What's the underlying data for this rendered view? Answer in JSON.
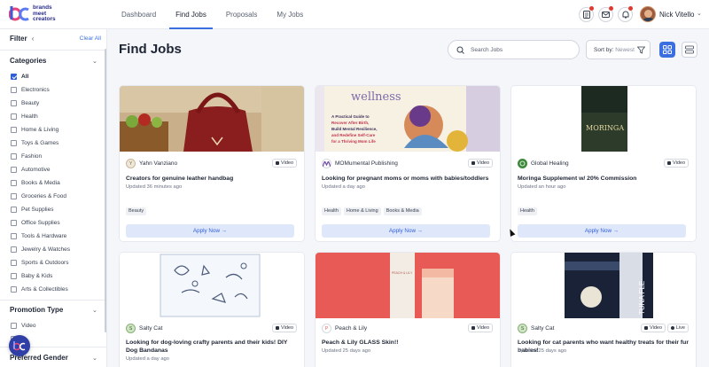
{
  "app": {
    "logo_text_1": "brands",
    "logo_text_2": "meet",
    "logo_text_3": "creators"
  },
  "nav": {
    "items": [
      {
        "label": "Dashboard"
      },
      {
        "label": "Find Jobs",
        "active": true
      },
      {
        "label": "Proposals"
      },
      {
        "label": "My Jobs"
      }
    ]
  },
  "header": {
    "icons": [
      "document-icon",
      "mail-icon",
      "bell-icon"
    ],
    "user_name": "Nick Vitello"
  },
  "sidebar": {
    "filter_label": "Filter",
    "collapse_symbol": "‹",
    "clear_all": "Clear All",
    "categories_title": "Categories",
    "categories": [
      {
        "label": "All",
        "checked": true
      },
      {
        "label": "Electronics"
      },
      {
        "label": "Beauty"
      },
      {
        "label": "Health"
      },
      {
        "label": "Home & Living"
      },
      {
        "label": "Toys & Games"
      },
      {
        "label": "Fashion"
      },
      {
        "label": "Automotive"
      },
      {
        "label": "Books & Media"
      },
      {
        "label": "Groceries & Food"
      },
      {
        "label": "Pet Supplies"
      },
      {
        "label": "Office Supplies"
      },
      {
        "label": "Tools & Hardware"
      },
      {
        "label": "Jewelry & Watches"
      },
      {
        "label": "Sports & Outdoors"
      },
      {
        "label": "Baby & Kids"
      },
      {
        "label": "Arts & Collectibles"
      }
    ],
    "promotion_title": "Promotion Type",
    "promotion_types": [
      {
        "label": "Video"
      }
    ],
    "gender_title": "Preferred Gender"
  },
  "main": {
    "title": "Find Jobs",
    "search_placeholder": "Search Jobs",
    "sort_label": "Sort by:",
    "sort_value": "Newest",
    "apply_label": "Apply Now",
    "cards": [
      {
        "brand": "Yahn Vanziano",
        "badges": [
          "Video"
        ],
        "title": "Creators for genuine leather handbag",
        "time": "Updated 36 minutes ago",
        "tags": [
          "Beauty"
        ],
        "image": "leather-handbag"
      },
      {
        "brand": "MOMumental Publishing",
        "badges": [
          "Video"
        ],
        "title": "Looking for pregnant moms or moms with babies/toddlers",
        "time": "Updated a day ago",
        "tags": [
          "Health",
          "Home & Living",
          "Books & Media"
        ],
        "image": "wellness-book",
        "img_text": {
          "wellness": "wellness",
          "line1": "A Practical Guide to",
          "line2": "Recover After Birth,",
          "line3": "Build Mental Resilience,",
          "line4": "and Redefine Self-Care",
          "line5": "for a Thriving Mom Life"
        }
      },
      {
        "brand": "Global Healing",
        "badges": [
          "Video"
        ],
        "title": "Moringa Supplement w/ 20% Commission",
        "time": "Updated an hour ago",
        "tags": [
          "Health"
        ],
        "image": "moringa-bottle",
        "img_text": {
          "label": "MORINGA"
        }
      },
      {
        "brand": "Salty Cat",
        "badges": [
          "Video"
        ],
        "title": "Looking for dog-loving crafty parents and their kids! DIY Dog Bandanas",
        "time": "Updated a day ago",
        "tags": [],
        "image": "dog-bandana"
      },
      {
        "brand": "Peach & Lily",
        "badges": [
          "Video"
        ],
        "title": "Peach & Lily GLASS Skin!!",
        "time": "Updated 25 days ago",
        "tags": [],
        "image": "peach-lily-product",
        "img_text": {
          "label": "PEACH & LILY"
        }
      },
      {
        "brand": "Salty Cat",
        "badges": [
          "Video",
          "Live"
        ],
        "title": "Looking for cat parents who want healthy treats for their fur babies!",
        "time": "Updated 25 days ago",
        "tags": [],
        "image": "tuna-flakes",
        "img_text": {
          "label": "TUNA FLE"
        }
      }
    ]
  },
  "colors": {
    "accent": "#3b6fe0",
    "apply_bg": "#dfe7fb",
    "notification_dot": "#e03a2f"
  }
}
